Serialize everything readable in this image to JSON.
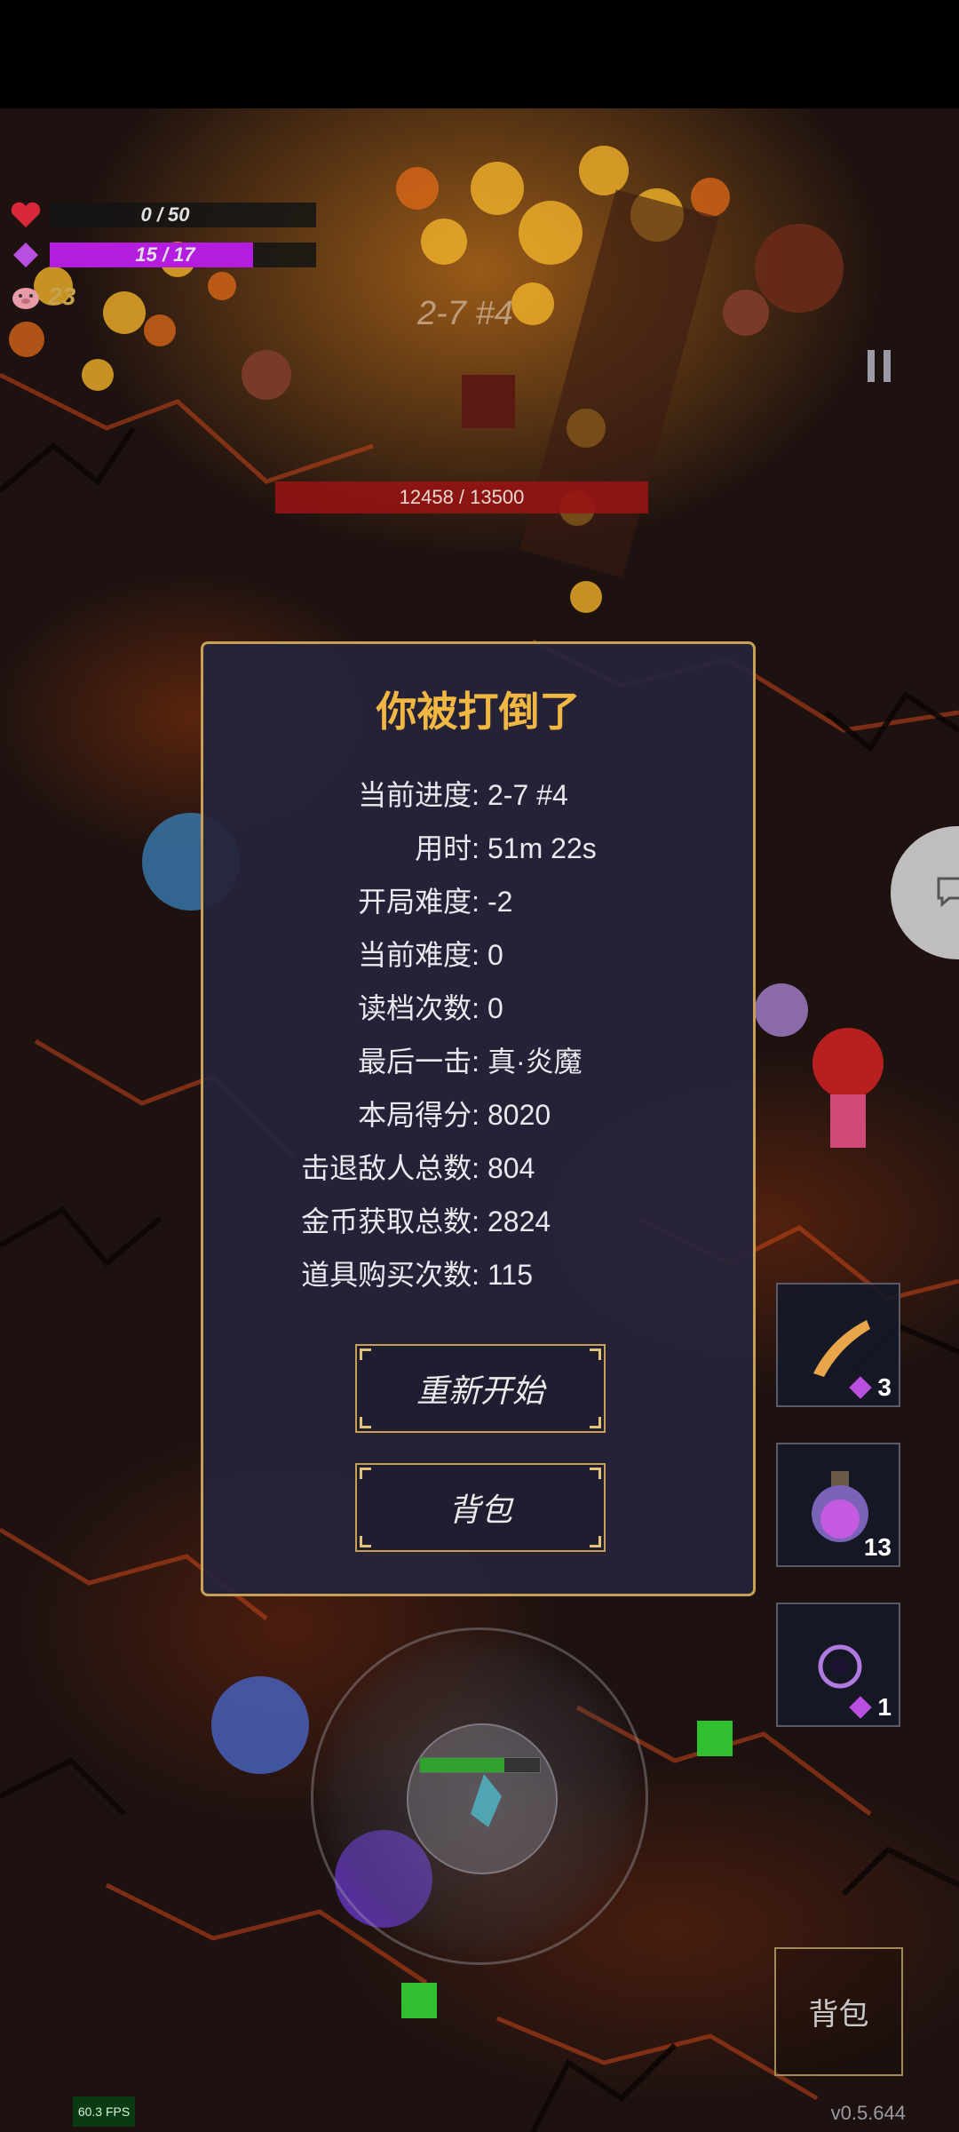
{
  "hud": {
    "hp": {
      "text": "0 / 50",
      "current": 0,
      "max": 50,
      "icon": "heart-icon",
      "color": "#d8283a"
    },
    "mana": {
      "text": "15 / 17",
      "current": 15,
      "max": 17,
      "icon": "diamond-icon",
      "color": "#b41ce0"
    },
    "coins": {
      "value": "23",
      "icon": "pig-icon"
    },
    "stage": "2-7 #4",
    "boss_hp": {
      "text": "12458 / 13500",
      "current": 12458,
      "max": 13500
    }
  },
  "dialog": {
    "title": "你被打倒了",
    "stats": [
      {
        "label": "当前进度:",
        "value": "2-7 #4"
      },
      {
        "label": "用时:",
        "value": "51m 22s"
      },
      {
        "label": "开局难度:",
        "value": "-2"
      },
      {
        "label": "当前难度:",
        "value": "0"
      },
      {
        "label": "读档次数:",
        "value": "0"
      },
      {
        "label": "最后一击:",
        "value": "真·炎魔"
      },
      {
        "label": "本局得分:",
        "value": "8020"
      },
      {
        "label": "击退敌人总数:",
        "value": "804"
      },
      {
        "label": "金币获取总数:",
        "value": "2824"
      },
      {
        "label": "道具购买次数:",
        "value": "115"
      }
    ],
    "restart_label": "重新开始",
    "bag_label": "背包"
  },
  "side": {
    "skills": [
      {
        "count": "3",
        "icon": "horn-icon",
        "gem": true
      },
      {
        "count": "13",
        "icon": "potion-icon",
        "gem": false
      },
      {
        "count": "1",
        "icon": "void-orb-icon",
        "gem": true
      }
    ],
    "bag_label": "背包",
    "chat_icon": "chat-icon"
  },
  "footer": {
    "fps": "60.3 FPS",
    "version": "v0.5.644"
  },
  "colors": {
    "accent_gold": "#f0b842",
    "dialog_border": "#c8a055",
    "mana": "#b41ce0",
    "lava": "#ff7a1a"
  }
}
